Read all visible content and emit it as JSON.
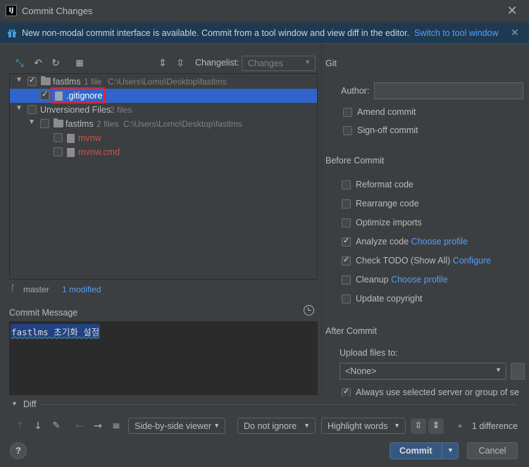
{
  "window": {
    "title": "Commit Changes",
    "app_icon": "intellij-icon"
  },
  "banner": {
    "text": "New non-modal commit interface is available. Commit from a tool window and view diff in the editor.",
    "link": "Switch to tool window",
    "icon": "gift-icon"
  },
  "toolbar": {
    "changelist_label": "Changelist:",
    "changelist_value": "Changes"
  },
  "tree": {
    "root": {
      "label": "fastlms",
      "count": "1 file",
      "path": "C:\\Users\\Lomo\\Desktop\\fastlms"
    },
    "root_file": ".gitignore",
    "unversioned": {
      "label": "Unversioned Files",
      "count": "2 files"
    },
    "unversioned_folder": {
      "label": "fastlms",
      "count": "2 files",
      "path": "C:\\Users\\Lomo\\Desktop\\fastlms"
    },
    "unversioned_files": [
      "mvnw",
      "mvnw.cmd"
    ]
  },
  "status": {
    "branch": "master",
    "modified": "1 modified"
  },
  "commit": {
    "label": "Commit Message",
    "message": "fastlms 초기화 설정"
  },
  "git": {
    "title": "Git",
    "author_label": "Author:",
    "author_value": "",
    "amend": "Amend commit",
    "signoff": "Sign-off commit"
  },
  "before_commit": {
    "title": "Before Commit",
    "items": [
      {
        "label": "Reformat code",
        "checked": false,
        "link": ""
      },
      {
        "label": "Rearrange code",
        "checked": false,
        "link": ""
      },
      {
        "label": "Optimize imports",
        "checked": false,
        "link": ""
      },
      {
        "label": "Analyze code",
        "checked": true,
        "link": "Choose profile"
      },
      {
        "label": "Check TODO (Show All)",
        "checked": true,
        "link": "Configure"
      },
      {
        "label": "Cleanup",
        "checked": false,
        "link": "Choose profile"
      },
      {
        "label": "Update copyright",
        "checked": false,
        "link": ""
      }
    ]
  },
  "after_commit": {
    "title": "After Commit",
    "upload_label": "Upload files to:",
    "upload_value": "<None>",
    "always_use": "Always use selected server or group of servers"
  },
  "diff": {
    "label": "Diff",
    "viewer": "Side-by-side viewer",
    "ignore": "Do not ignore",
    "highlight": "Highlight words",
    "count": "1 difference"
  },
  "buttons": {
    "help": "?",
    "commit": "Commit",
    "cancel": "Cancel"
  },
  "colors": {
    "accent": "#365880",
    "link": "#589df6",
    "unversioned": "#c75450",
    "selection": "#2f65ca"
  }
}
